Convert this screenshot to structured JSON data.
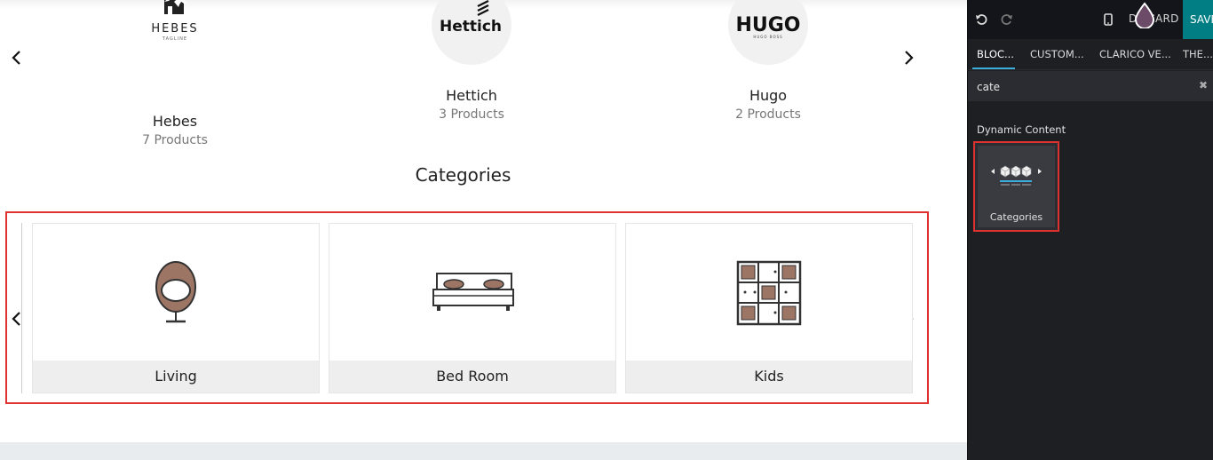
{
  "brands": [
    {
      "name": "Hebes",
      "count": "7 Products",
      "logo_text": "HEBES",
      "logo_sub": "TAGLINE",
      "icon": "hebes-house-logo"
    },
    {
      "name": "Hettich",
      "count": "3 Products",
      "logo_text": "Hettich",
      "icon": "hettich-logo"
    },
    {
      "name": "Hugo",
      "count": "2 Products",
      "logo_text": "HUGO",
      "logo_sub": "HUGO BOSS",
      "icon": "hugo-logo"
    }
  ],
  "categories_section": {
    "title": "Categories",
    "items": [
      {
        "label": "Living",
        "icon": "egg-chair-icon"
      },
      {
        "label": "Bed Room",
        "icon": "bed-icon"
      },
      {
        "label": "Kids",
        "icon": "shelf-cabinet-icon"
      }
    ]
  },
  "editor": {
    "topbar": {
      "undo_icon": "undo-icon",
      "redo_icon": "redo-icon",
      "mobile_icon": "mobile-preview-icon",
      "discard_label": "DISCARD",
      "save_label": "SAVE"
    },
    "tabs": [
      "BLOC...",
      "CUSTOM...",
      "CLARICO VE...",
      "THE..."
    ],
    "search": {
      "value": "cate"
    },
    "section_title": "Dynamic Content",
    "snippet": {
      "label": "Categories",
      "icon": "categories-carousel-icon"
    }
  },
  "colors": {
    "highlight": "#e03131",
    "sidebar_bg": "#1e1f23",
    "save_bg": "#017e84",
    "accent_underline": "#3aadd9",
    "furniture_brown": "#9c7565"
  }
}
